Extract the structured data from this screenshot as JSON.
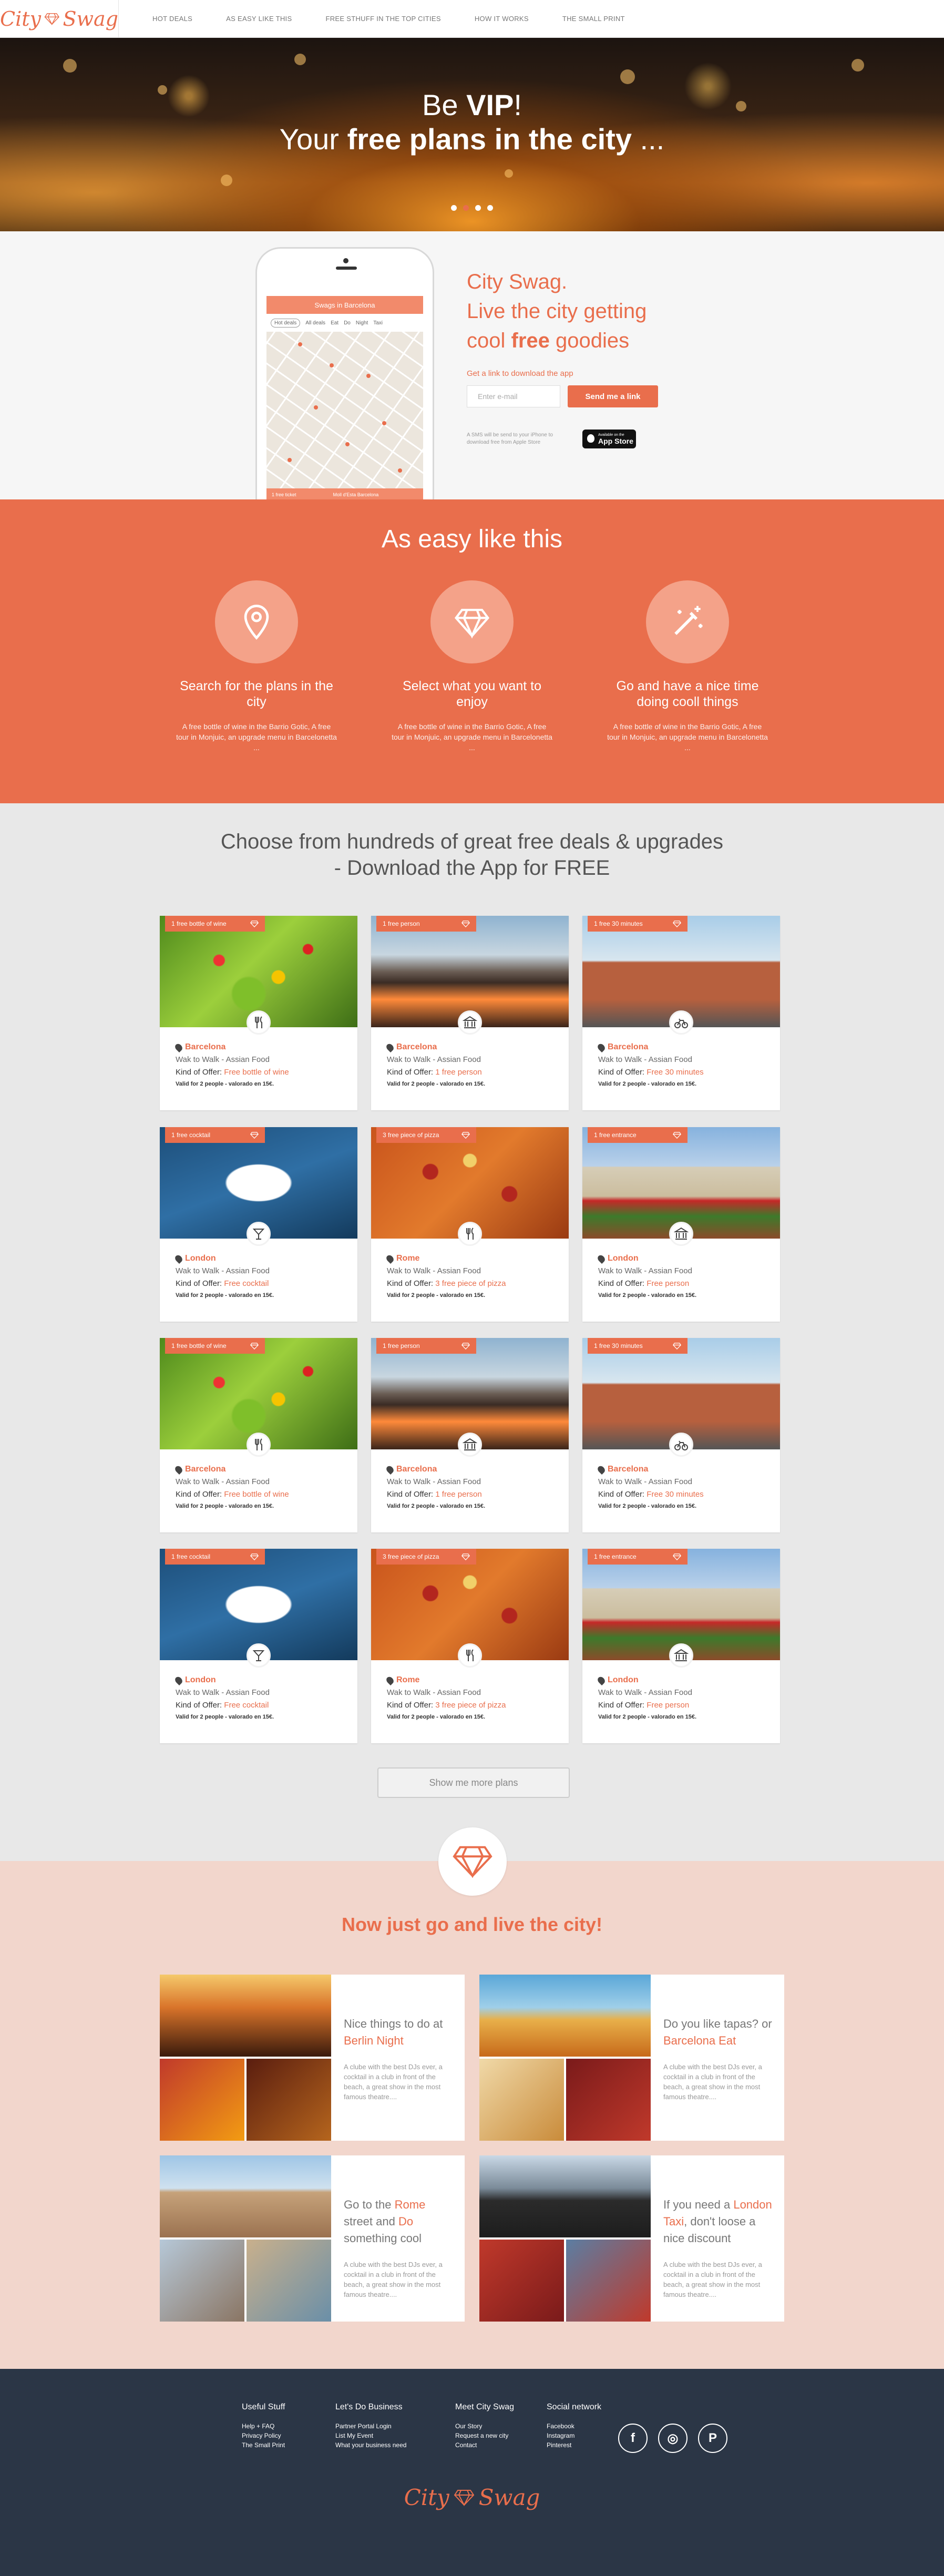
{
  "brand": {
    "name_left": "City",
    "name_right": "Swag",
    "accent": "#e96e4c",
    "footer_bg": "#2b3646"
  },
  "nav": {
    "items": [
      "HOT DEALS",
      "AS EASY LIKE THIS",
      "FREE STHUFF IN THE TOP CITIES",
      "HOW IT WORKS",
      "THE SMALL PRINT"
    ]
  },
  "hero": {
    "line1_pre": "Be ",
    "line1_bold": "VIP",
    "line1_post": "!",
    "line2_pre": "Your ",
    "line2_bold": "free plans in the city",
    "line2_post": " ...",
    "slide_count": 4,
    "active_slide": 2
  },
  "phone": {
    "title": "Swags in Barcelona",
    "filters": [
      "Hot deals",
      "All deals",
      "Eat",
      "Do",
      "Night",
      "Taxi"
    ],
    "bottom_left": "1 free ticket",
    "bottom_right": "Moll d'Esta Barcelona"
  },
  "app": {
    "line1": "City Swag.",
    "line2": "Live the city getting",
    "line3_pre": "cool ",
    "line3_bold": "free",
    "line3_post": " goodies",
    "hint": "Get a link to download the app",
    "email_placeholder": "Enter e-mail",
    "send_label": "Send me a link",
    "note": "A SMS will be send to your iPhone to download free from Apple Store",
    "store_small": "Available on the",
    "store_big": "App Store"
  },
  "how": {
    "title": "As easy like this",
    "steps": [
      {
        "icon": "location-pin-icon",
        "title": "Search for the plans in the city",
        "desc": "A free bottle of wine in the Barrio Gotic, A free tour in Monjuic, an upgrade menu in Barcelonetta ..."
      },
      {
        "icon": "diamond-icon",
        "title": "Select what you want to enjoy",
        "desc": "A free bottle of wine in the Barrio Gotic, A free tour in Monjuic, an upgrade menu in Barcelonetta ..."
      },
      {
        "icon": "magic-wand-icon",
        "title": "Go and have a nice time doing cooll things",
        "desc": "A free bottle of wine in the Barrio Gotic, A free tour in Monjuic, an upgrade menu in Barcelonetta ..."
      }
    ]
  },
  "deals": {
    "title_line1": "Choose from hundreds of great free deals & upgrades",
    "title_line2": "- Download the App for FREE",
    "more_label": "Show me more plans",
    "place": "Wak to Walk - Assian Food",
    "kind_label": "Kind of Offer: ",
    "valid": "Valid for 2 people - valorado en 15€.",
    "cards": [
      {
        "tag": "1 free bottle of wine",
        "city": "Barcelona",
        "offer": "Free bottle of wine",
        "icon": "cutlery-icon",
        "img": "salad"
      },
      {
        "tag": "1 free person",
        "city": "Barcelona",
        "offer": "1 free person",
        "icon": "museum-icon",
        "img": "fountain"
      },
      {
        "tag": "1 free 30 minutes",
        "city": "Barcelona",
        "offer": "Free 30 minutes",
        "icon": "bike-icon",
        "img": "arch"
      },
      {
        "tag": "1 free cocktail",
        "city": "London",
        "offer": "Free cocktail",
        "icon": "cocktail-icon",
        "img": "boat"
      },
      {
        "tag": "3 free piece of pizza",
        "city": "Rome",
        "offer": "3 free piece of pizza",
        "icon": "cutlery-icon",
        "img": "pizza"
      },
      {
        "tag": "1 free entrance",
        "city": "London",
        "offer": "Free person",
        "icon": "museum-icon",
        "img": "palace"
      },
      {
        "tag": "1 free bottle of wine",
        "city": "Barcelona",
        "offer": "Free bottle of wine",
        "icon": "cutlery-icon",
        "img": "salad"
      },
      {
        "tag": "1 free person",
        "city": "Barcelona",
        "offer": "1 free person",
        "icon": "museum-icon",
        "img": "fountain"
      },
      {
        "tag": "1 free 30 minutes",
        "city": "Barcelona",
        "offer": "Free 30 minutes",
        "icon": "bike-icon",
        "img": "arch"
      },
      {
        "tag": "1 free cocktail",
        "city": "London",
        "offer": "Free cocktail",
        "icon": "cocktail-icon",
        "img": "boat"
      },
      {
        "tag": "3 free piece of pizza",
        "city": "Rome",
        "offer": "3 free piece of pizza",
        "icon": "cutlery-icon",
        "img": "pizza"
      },
      {
        "tag": "1 free entrance",
        "city": "London",
        "offer": "Free person",
        "icon": "museum-icon",
        "img": "palace"
      }
    ]
  },
  "live": {
    "title": "Now just go and live the city!",
    "desc": "A clube with the best DJs ever, a cocktail in a club in front of the beach, a great show in the most famous theatre....",
    "cards": [
      {
        "h1": "Nice things to do at",
        "h2": "Berlin Night",
        "theme": "night"
      },
      {
        "h1": "Do you like tapas? or",
        "h2": "Barcelona Eat",
        "theme": "food"
      },
      {
        "h1": "Go to the ",
        "h2": "Rome",
        "h3": " street and ",
        "h4": "Do",
        "h5": " something cool",
        "theme": "rome"
      },
      {
        "h1": "If you need a ",
        "h2": "London Taxi",
        "h3": ",  don't loose a nice discount",
        "theme": "taxi"
      }
    ]
  },
  "footer": {
    "cols": [
      {
        "title": "Useful Stuff",
        "links": [
          "Help + FAQ",
          "Privacy Policy",
          "The Small Print"
        ]
      },
      {
        "title": "Let's Do Business",
        "links": [
          "Partner Portal Login",
          "List My Event",
          "What your business need"
        ]
      },
      {
        "title": "Meet City Swag",
        "links": [
          "Our Story",
          "Request a new city",
          "Contact"
        ]
      },
      {
        "title": "Social network",
        "links": [
          "Facebook",
          "Instagram",
          "Pinterest"
        ]
      }
    ],
    "social": [
      {
        "icon": "facebook-icon",
        "glyph": "f"
      },
      {
        "icon": "instagram-icon",
        "glyph": "◎"
      },
      {
        "icon": "pinterest-icon",
        "glyph": "P"
      }
    ]
  }
}
